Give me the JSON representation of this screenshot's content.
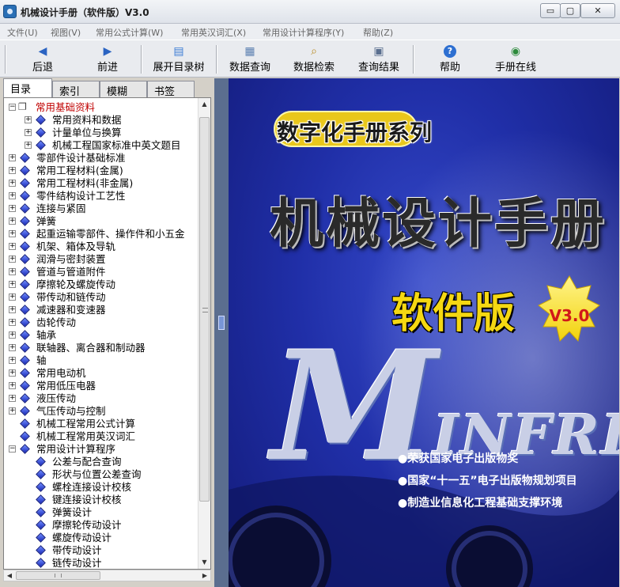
{
  "window": {
    "title": "机械设计手册（软件版）V3.0",
    "controls": {
      "minimize": "▭",
      "maximize": "▢",
      "close": "✕"
    }
  },
  "menu": [
    "文件(U)",
    "视图(V)",
    "常用公式计算(W)",
    "常用英汉词汇(X)",
    "常用设计计算程序(Y)",
    "帮助(Z)"
  ],
  "toolbar": {
    "back": {
      "label": "后退",
      "icon": "arrow-left-icon"
    },
    "forward": {
      "label": "前进",
      "icon": "arrow-right-icon"
    },
    "expand_tree": {
      "label": "展开目录树",
      "icon": "book-icon"
    },
    "data_query": {
      "label": "数据查询",
      "icon": "database-icon"
    },
    "data_search": {
      "label": "数据检索",
      "icon": "search-icon"
    },
    "query_result": {
      "label": "查询结果",
      "icon": "document-icon"
    },
    "help": {
      "label": "帮助",
      "icon": "help-icon"
    },
    "online": {
      "label": "手册在线",
      "icon": "globe-icon"
    }
  },
  "tabs": [
    "目录",
    "索引",
    "模糊",
    "书签"
  ],
  "tree": [
    {
      "label": "常用基础资料",
      "level": 0,
      "expander": "⊟",
      "icon": "open-book-icon",
      "root": true
    },
    {
      "label": "常用资料和数据",
      "level": 1,
      "expander": "⊞",
      "icon": "diamond-icon"
    },
    {
      "label": "计量单位与换算",
      "level": 1,
      "expander": "⊞",
      "icon": "diamond-icon"
    },
    {
      "label": "机械工程国家标准中英文题目",
      "level": 1,
      "expander": "⊞",
      "icon": "diamond-icon"
    },
    {
      "label": "零部件设计基础标准",
      "level": 0,
      "expander": "⊞",
      "icon": "diamond-icon"
    },
    {
      "label": "常用工程材料(金属)",
      "level": 0,
      "expander": "⊞",
      "icon": "diamond-icon"
    },
    {
      "label": "常用工程材料(非金属)",
      "level": 0,
      "expander": "⊞",
      "icon": "diamond-icon"
    },
    {
      "label": "零件结构设计工艺性",
      "level": 0,
      "expander": "⊞",
      "icon": "diamond-icon"
    },
    {
      "label": "连接与紧固",
      "level": 0,
      "expander": "⊞",
      "icon": "diamond-icon"
    },
    {
      "label": "弹簧",
      "level": 0,
      "expander": "⊞",
      "icon": "diamond-icon"
    },
    {
      "label": "起重运输零部件、操作件和小五金",
      "level": 0,
      "expander": "⊞",
      "icon": "diamond-icon"
    },
    {
      "label": "机架、箱体及导轨",
      "level": 0,
      "expander": "⊞",
      "icon": "diamond-icon"
    },
    {
      "label": "润滑与密封装置",
      "level": 0,
      "expander": "⊞",
      "icon": "diamond-icon"
    },
    {
      "label": "管道与管道附件",
      "level": 0,
      "expander": "⊞",
      "icon": "diamond-icon"
    },
    {
      "label": "摩擦轮及螺旋传动",
      "level": 0,
      "expander": "⊞",
      "icon": "diamond-icon"
    },
    {
      "label": "带传动和链传动",
      "level": 0,
      "expander": "⊞",
      "icon": "diamond-icon"
    },
    {
      "label": "减速器和变速器",
      "level": 0,
      "expander": "⊞",
      "icon": "diamond-icon"
    },
    {
      "label": "齿轮传动",
      "level": 0,
      "expander": "⊞",
      "icon": "diamond-icon"
    },
    {
      "label": "轴承",
      "level": 0,
      "expander": "⊞",
      "icon": "diamond-icon"
    },
    {
      "label": "联轴器、离合器和制动器",
      "level": 0,
      "expander": "⊞",
      "icon": "diamond-icon"
    },
    {
      "label": "轴",
      "level": 0,
      "expander": "⊞",
      "icon": "diamond-icon"
    },
    {
      "label": "常用电动机",
      "level": 0,
      "expander": "⊞",
      "icon": "diamond-icon"
    },
    {
      "label": "常用低压电器",
      "level": 0,
      "expander": "⊞",
      "icon": "diamond-icon"
    },
    {
      "label": "液压传动",
      "level": 0,
      "expander": "⊞",
      "icon": "diamond-icon"
    },
    {
      "label": "气压传动与控制",
      "level": 0,
      "expander": "⊞",
      "icon": "diamond-icon"
    },
    {
      "label": "机械工程常用公式计算",
      "level": 0,
      "expander": "",
      "icon": "diamond-icon"
    },
    {
      "label": "机械工程常用英汉词汇",
      "level": 0,
      "expander": "",
      "icon": "diamond-icon"
    },
    {
      "label": "常用设计计算程序",
      "level": 0,
      "expander": "⊟",
      "icon": "diamond-icon"
    },
    {
      "label": "公差与配合查询",
      "level": 1,
      "expander": "",
      "icon": "diamond-icon"
    },
    {
      "label": "形状与位置公差查询",
      "level": 1,
      "expander": "",
      "icon": "diamond-icon"
    },
    {
      "label": "螺栓连接设计校核",
      "level": 1,
      "expander": "",
      "icon": "diamond-icon"
    },
    {
      "label": "键连接设计校核",
      "level": 1,
      "expander": "",
      "icon": "diamond-icon"
    },
    {
      "label": "弹簧设计",
      "level": 1,
      "expander": "",
      "icon": "diamond-icon"
    },
    {
      "label": "摩擦轮传动设计",
      "level": 1,
      "expander": "",
      "icon": "diamond-icon"
    },
    {
      "label": "螺旋传动设计",
      "level": 1,
      "expander": "",
      "icon": "diamond-icon"
    },
    {
      "label": "带传动设计",
      "level": 1,
      "expander": "",
      "icon": "diamond-icon"
    },
    {
      "label": "链传动设计",
      "level": 1,
      "expander": "",
      "icon": "diamond-icon"
    }
  ],
  "cover": {
    "series": "数字化手册系列",
    "title": "机械设计手册",
    "edition": "软件版",
    "version": "V3.0",
    "brand_initial": "M",
    "brand_rest": "INFRE",
    "bullets": [
      "●荣获国家电子出版物奖",
      "●国家“十一五”电子出版物规划项目",
      "●制造业信息化工程基础支撑环境"
    ],
    "colors": {
      "background": "#202fa8",
      "title_yellow": "#f5d812",
      "badge": "#f6e21a",
      "version_red": "#d11919"
    }
  }
}
